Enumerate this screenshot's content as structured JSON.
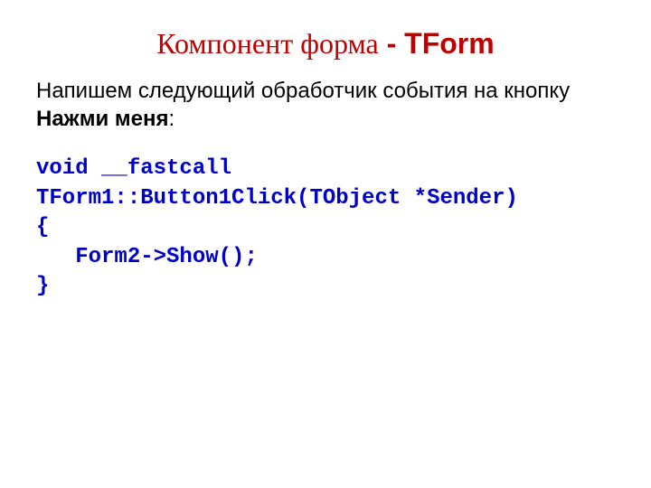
{
  "title": {
    "part1": "Компонент форма",
    "dash": " - ",
    "part2": "TForm"
  },
  "body": {
    "line1": "Напишем следующий обработчик события на кнопку ",
    "bold": "Нажми меня",
    "colon": ":"
  },
  "code": {
    "l1": "void __fastcall",
    "l2": "TForm1::Button1Click(TObject *Sender)",
    "l3": "{",
    "l4": "   Form2->Show();",
    "l5": "}"
  }
}
